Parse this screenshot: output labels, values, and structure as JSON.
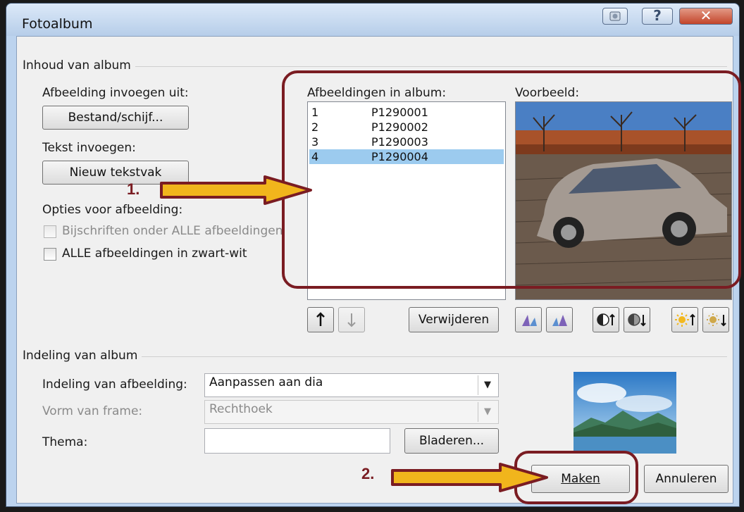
{
  "window": {
    "title": "Fotoalbum"
  },
  "content": {
    "group_title": "Inhoud van album",
    "insert_picture_from": "Afbeelding invoegen uit:",
    "file_disk_button": "Bestand/schijf...",
    "insert_text": "Tekst invoegen:",
    "new_textbox_button": "Nieuw tekstvak",
    "picture_options": "Opties voor afbeelding:",
    "captions_below": "Bijschriften onder ALLE afbeeldingen",
    "all_black_white": "ALLE afbeeldingen in zwart-wit",
    "pictures_in_album_label": "Afbeeldingen in album:",
    "pictures": [
      {
        "num": "1",
        "name": "P1290001"
      },
      {
        "num": "2",
        "name": "P1290002"
      },
      {
        "num": "3",
        "name": "P1290003"
      },
      {
        "num": "4",
        "name": "P1290004"
      }
    ],
    "selected_index": 3,
    "preview_label": "Voorbeeld:",
    "remove_button": "Verwijderen"
  },
  "layout_group": {
    "group_title": "Indeling van album",
    "picture_layout_label": "Indeling van afbeelding:",
    "picture_layout_value": "Aanpassen aan dia",
    "frame_shape_label": "Vorm van frame:",
    "frame_shape_value": "Rechthoek",
    "theme_label": "Thema:",
    "theme_value": "",
    "browse_button": "Bladeren..."
  },
  "actions": {
    "create_button": "Maken",
    "cancel_button": "Annuleren"
  },
  "annotations": {
    "step1": "1.",
    "step2": "2."
  },
  "colors": {
    "annotation": "#7a1c22",
    "arrow_fill": "#f1b51c",
    "selection": "#9ccbef"
  }
}
